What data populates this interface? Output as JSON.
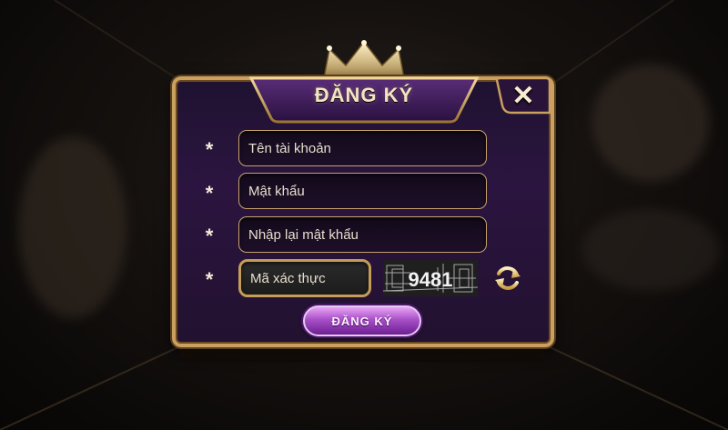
{
  "dialog": {
    "title": "ĐĂNG KÝ",
    "close_label": "✕"
  },
  "form": {
    "required_mark": "*",
    "username": {
      "placeholder": "Tên tài khoản",
      "value": ""
    },
    "password": {
      "placeholder": "Mật khẩu",
      "value": ""
    },
    "confirm_password": {
      "placeholder": "Nhập lại mật khẩu",
      "value": ""
    },
    "captcha_input": {
      "placeholder": "Mã xác thực",
      "value": ""
    },
    "captcha_code": "9481",
    "submit_label": "ĐĂNG KÝ"
  },
  "icons": {
    "close": "close-icon",
    "refresh": "refresh-icon",
    "crown": "crown-icon"
  },
  "colors": {
    "gold_border": "#c9a060",
    "panel_purple": "#2b1540",
    "button_purple": "#a850c8",
    "text_cream": "#f3e5c2"
  }
}
